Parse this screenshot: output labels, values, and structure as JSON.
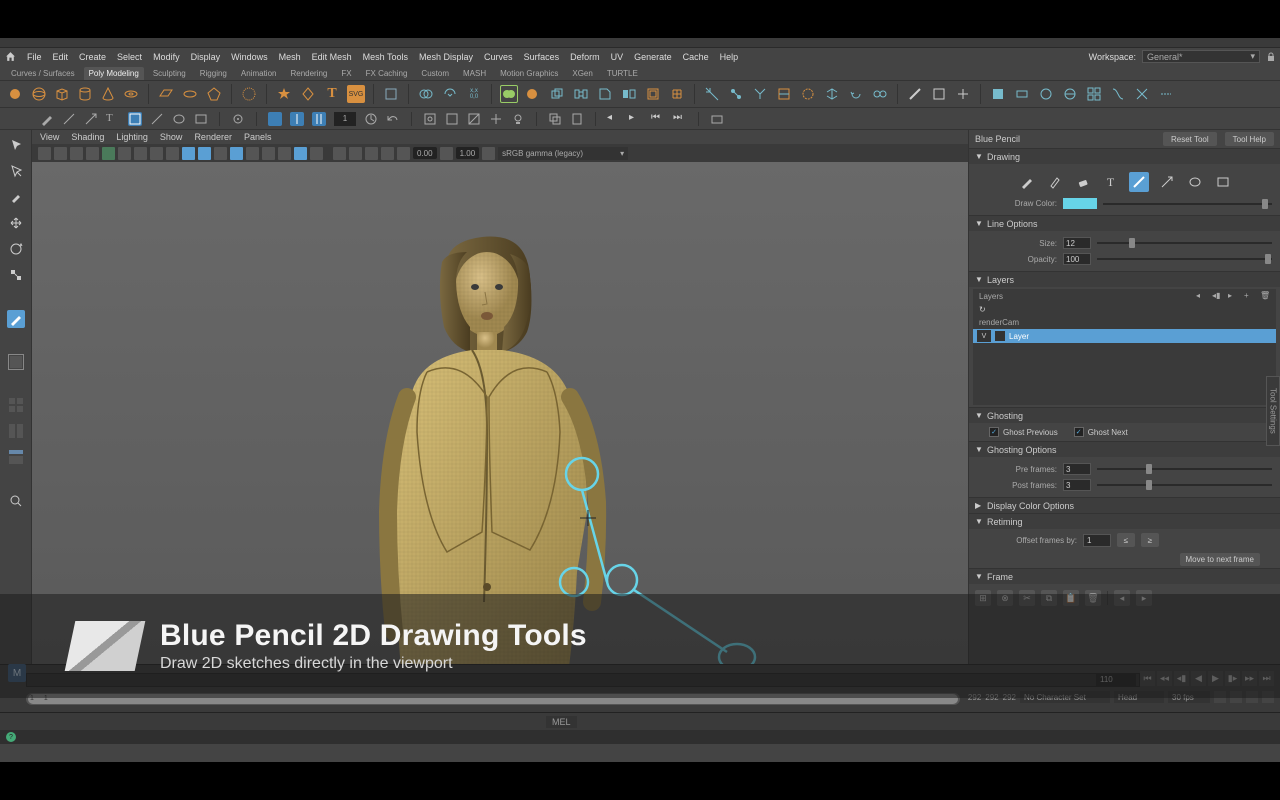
{
  "workspace": {
    "label": "Workspace:",
    "value": "General*"
  },
  "menu": [
    "File",
    "Edit",
    "Create",
    "Select",
    "Modify",
    "Display",
    "Windows",
    "Mesh",
    "Edit Mesh",
    "Mesh Tools",
    "Mesh Display",
    "Curves",
    "Surfaces",
    "Deform",
    "UV",
    "Generate",
    "Cache",
    "Help"
  ],
  "shelfTabs": [
    "Curves / Surfaces",
    "Poly Modeling",
    "Sculpting",
    "Rigging",
    "Animation",
    "Rendering",
    "FX",
    "FX Caching",
    "Custom",
    "MASH",
    "Motion Graphics",
    "XGen",
    "TURTLE"
  ],
  "shelfActive": "Poly Modeling",
  "vpMenu": [
    "View",
    "Shading",
    "Lighting",
    "Show",
    "Renderer",
    "Panels"
  ],
  "vpExposure": "0.00",
  "vpGamma": "1.00",
  "vpColorspace": "sRGB gamma (legacy)",
  "toolbar2Num": "1",
  "rightPanel": {
    "title": "Blue Pencil",
    "reset": "Reset Tool",
    "help": "Tool Help",
    "sections": {
      "drawing": "Drawing",
      "drawColor": "Draw Color:",
      "lineOptions": "Line Options",
      "size": "Size:",
      "sizeVal": "12",
      "opacity": "Opacity:",
      "opacityVal": "100",
      "layers": "Layers",
      "layersLbl": "Layers",
      "renderCam": "renderCam",
      "layerV": "V",
      "layerName": "Layer",
      "ghosting": "Ghosting",
      "ghostPrev": "Ghost Previous",
      "ghostNext": "Ghost Next",
      "ghostOpt": "Ghosting Options",
      "preFrames": "Pre frames:",
      "preVal": "3",
      "postFrames": "Post frames:",
      "postVal": "3",
      "dispColor": "Display Color Options",
      "retiming": "Retiming",
      "offset": "Offset frames by:",
      "offsetVal": "1",
      "moveNext": "Move to next frame",
      "frame": "Frame"
    }
  },
  "timeline": {
    "current": "110",
    "rangeNums": [
      "1",
      "1"
    ],
    "r2": [
      "292",
      "292",
      "292"
    ],
    "charset": "No Character Set",
    "head": "Head",
    "fps": "30 fps"
  },
  "cmd": {
    "mel": "MEL"
  },
  "overlay": {
    "title": "Blue Pencil 2D Drawing Tools",
    "sub": "Draw 2D sketches directly in the viewport"
  },
  "sideTab": "Tool Settings",
  "badge": "M"
}
